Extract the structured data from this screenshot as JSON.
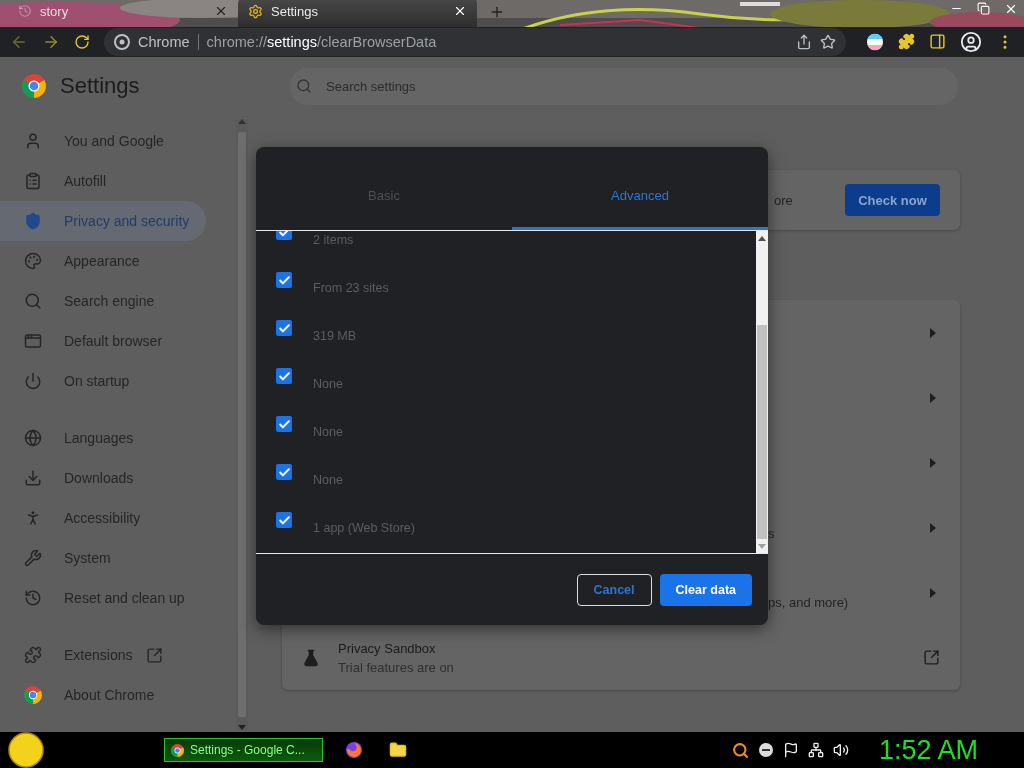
{
  "browser": {
    "tabs": [
      {
        "title": "story",
        "selected": false
      },
      {
        "title": "Settings",
        "selected": true
      }
    ],
    "address": {
      "site": "Chrome",
      "url": "chrome://**settings**/clearBrowserData"
    }
  },
  "settings": {
    "title": "Settings",
    "search": {
      "placeholder": "Search settings"
    },
    "sidebar": {
      "groups": [
        {
          "items": [
            {
              "label": "You and Google",
              "selected": false,
              "external": false
            },
            {
              "label": "Autofill",
              "selected": false,
              "external": false
            },
            {
              "label": "Privacy and security",
              "selected": true,
              "external": false
            },
            {
              "label": "Appearance",
              "selected": false,
              "external": false
            },
            {
              "label": "Search engine",
              "selected": false,
              "external": false
            },
            {
              "label": "Default browser",
              "selected": false,
              "external": false
            },
            {
              "label": "On startup",
              "selected": false,
              "external": false
            }
          ]
        },
        {
          "items": [
            {
              "label": "Languages",
              "selected": false,
              "external": false
            },
            {
              "label": "Downloads",
              "selected": false,
              "external": false
            },
            {
              "label": "Accessibility",
              "selected": false,
              "external": false
            },
            {
              "label": "System",
              "selected": false,
              "external": false
            },
            {
              "label": "Reset and clean up",
              "selected": false,
              "external": false
            }
          ]
        },
        {
          "items": [
            {
              "label": "Extensions",
              "selected": false,
              "external": true
            },
            {
              "label": "About Chrome",
              "selected": false,
              "external": false
            }
          ]
        }
      ]
    },
    "safety_card": {
      "text": "ore",
      "button": "Check now"
    },
    "privacy_rows": [
      {
        "kind": "arrow"
      },
      {
        "kind": "arrow"
      },
      {
        "kind": "arrow"
      },
      {
        "kind": "arrow",
        "text": "s"
      },
      {
        "kind": "arrow",
        "text": "ps, and more)"
      },
      {
        "kind": "external",
        "title": "Privacy Sandbox",
        "subtitle": "Trial features are on"
      }
    ]
  },
  "dialog": {
    "tabs": [
      {
        "label": "Basic",
        "selected": false
      },
      {
        "label": "Advanced",
        "selected": true
      }
    ],
    "items": [
      {
        "detail": "2 items",
        "checked": true
      },
      {
        "detail": "From 23 sites",
        "checked": true
      },
      {
        "detail": "319 MB",
        "checked": true
      },
      {
        "detail": "None",
        "checked": true
      },
      {
        "detail": "None",
        "checked": true
      },
      {
        "detail": "None",
        "checked": true
      },
      {
        "detail": "1 app (Web Store)",
        "checked": true
      }
    ],
    "buttons": [
      {
        "label": "Cancel",
        "kind": "secondary"
      },
      {
        "label": "Clear data",
        "kind": "primary"
      }
    ]
  },
  "taskbar": {
    "tasks": [
      {
        "label": "Settings - Google C...",
        "selected": true
      }
    ],
    "clock": "1:52 AM"
  }
}
